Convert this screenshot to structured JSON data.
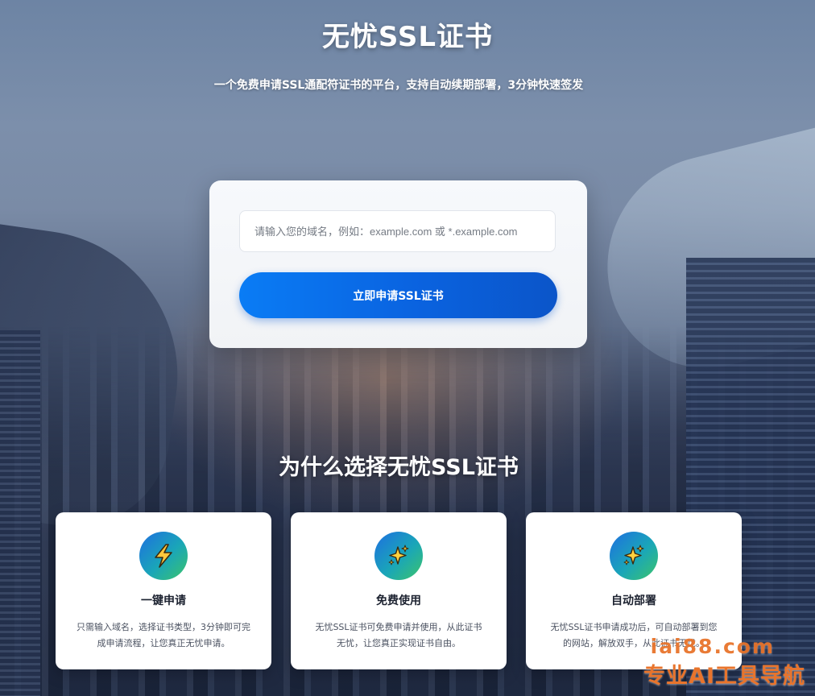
{
  "header": {
    "title": "无忧SSL证书",
    "subtitle": "一个免费申请SSL通配符证书的平台，支持自动续期部署，3分钟快速签发"
  },
  "apply": {
    "input_value": "",
    "input_placeholder": "请输入您的域名，例如：example.com 或 *.example.com",
    "button_label": "立即申请SSL证书"
  },
  "why": {
    "title": "为什么选择无忧SSL证书",
    "cards": [
      {
        "icon": "lightning-icon",
        "title": "一键申请",
        "desc": "只需输入域名，选择证书类型，3分钟即可完成申请流程，让您真正无忧申请。"
      },
      {
        "icon": "sparkles-icon",
        "title": "免费使用",
        "desc": "无忧SSL证书可免费申请并使用，从此证书无忧，让您真正实现证书自由。"
      },
      {
        "icon": "sparkles-icon",
        "title": "自动部署",
        "desc": "无忧SSL证书申请成功后，可自动部署到您的网站，解放双手，从此证书无忧。"
      }
    ]
  },
  "watermark": {
    "url": "iai88.com",
    "name": "专业AI工具导航"
  },
  "colors": {
    "primary_button": "#0a63e0",
    "icon_gradient_start": "#1e6fe0",
    "icon_gradient_end": "#3cc46a",
    "watermark": "#e8742c"
  }
}
